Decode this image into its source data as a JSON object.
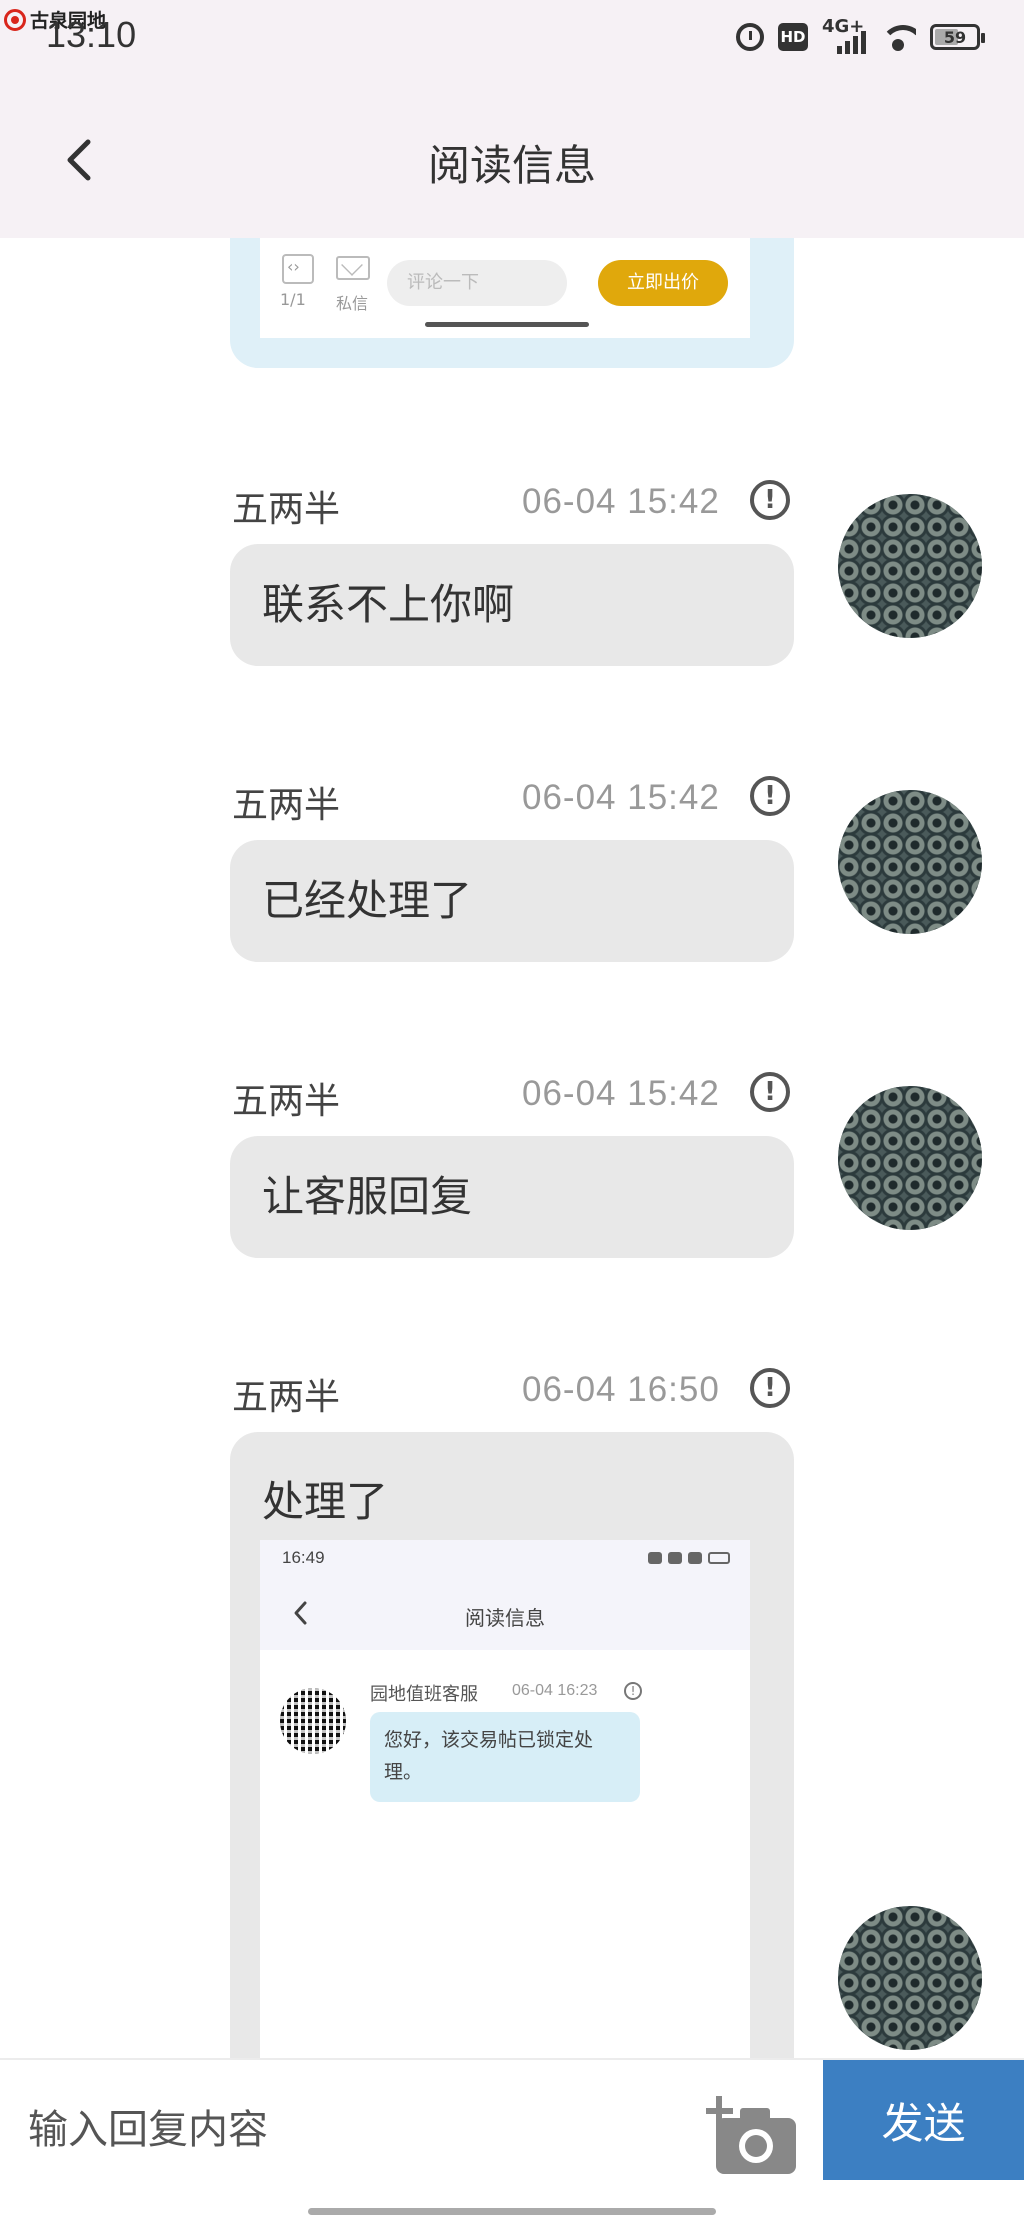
{
  "status_bar": {
    "app_badge": "古泉园地",
    "time": "13:10",
    "network": "4G+",
    "hd": "HD",
    "battery": "59"
  },
  "header": {
    "title": "阅读信息",
    "back_icon": "chevron-left-icon"
  },
  "top_card": {
    "page_indicator": "1/1",
    "private_message": "私信",
    "comment_placeholder": "评论一下",
    "offer_button": "立即出价"
  },
  "messages": [
    {
      "sender": "五两半",
      "time": "06-04 15:42",
      "text": "联系不上你啊"
    },
    {
      "sender": "五两半",
      "time": "06-04 15:42",
      "text": "已经处理了"
    },
    {
      "sender": "五两半",
      "time": "06-04 15:42",
      "text": "让客服回复"
    },
    {
      "sender": "五两半",
      "time": "06-04 16:50",
      "text": "处理了",
      "screenshot": {
        "time": "16:49",
        "title": "阅读信息",
        "sender": "园地值班客服",
        "msg_time": "06-04 16:23",
        "text": "您好，该交易帖已锁定处理。"
      }
    }
  ],
  "input_bar": {
    "placeholder": "输入回复内容",
    "camera_icon": "add-photo-camera-icon",
    "send_label": "发送"
  },
  "colors": {
    "send_button": "#3c7fc2",
    "offer_button": "#e0a80c",
    "bubble": "#e8e8e8",
    "header_bg": "#f6f1f5"
  }
}
